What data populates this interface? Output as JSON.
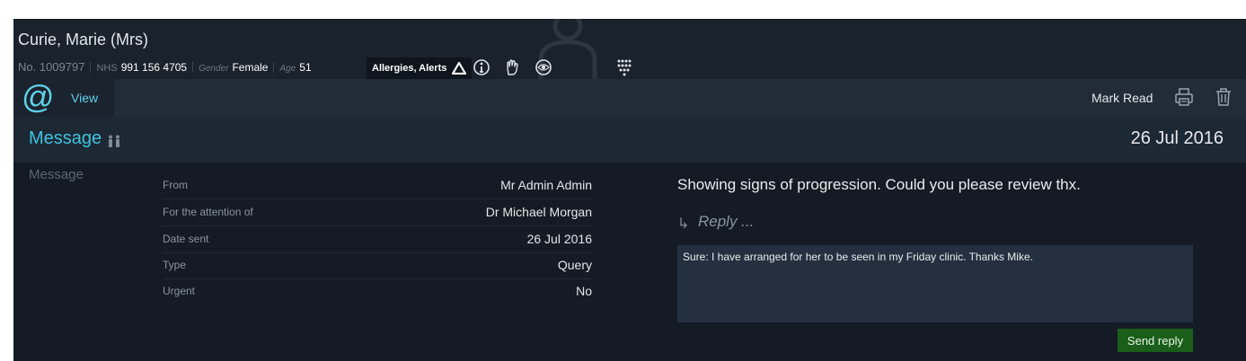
{
  "patient": {
    "name": "Curie, Marie (Mrs)",
    "number": "No. 1009797",
    "nhs_label": "NHS",
    "nhs_value": "991 156 4705",
    "gender_label": "Gender",
    "gender_value": "Female",
    "age_label": "Age",
    "age_value": "51",
    "alerts_label": "Allergies, Alerts"
  },
  "banner_icons": [
    "warning-triangle-icon",
    "info-circle-icon",
    "hand-icon",
    "eye-icon",
    "family-tree-icon"
  ],
  "toolbar": {
    "tab_icon": "at-sign-icon",
    "view_label": "View",
    "mark_read_label": "Mark Read",
    "icons": [
      "print-icon",
      "trash-icon"
    ]
  },
  "title": {
    "label": "Message",
    "date": "26 Jul 2016"
  },
  "section_label": "Message",
  "details": [
    {
      "label": "From",
      "value": "Mr Admin Admin"
    },
    {
      "label": "For the attention of",
      "value": "Dr Michael Morgan"
    },
    {
      "label": "Date sent",
      "value": "26 Jul 2016"
    },
    {
      "label": "Type",
      "value": "Query"
    },
    {
      "label": "Urgent",
      "value": "No"
    }
  ],
  "message": {
    "text": "Showing signs of progression. Could you please review thx.",
    "reply_label": "Reply ...",
    "reply_text": "Sure: I have arranged for her to be seen in my Friday clinic. Thanks Mike.",
    "send_label": "Send reply"
  },
  "colors": {
    "accent": "#3fc3dc",
    "send_button": "#1a5e1a",
    "background": "#141b24"
  }
}
